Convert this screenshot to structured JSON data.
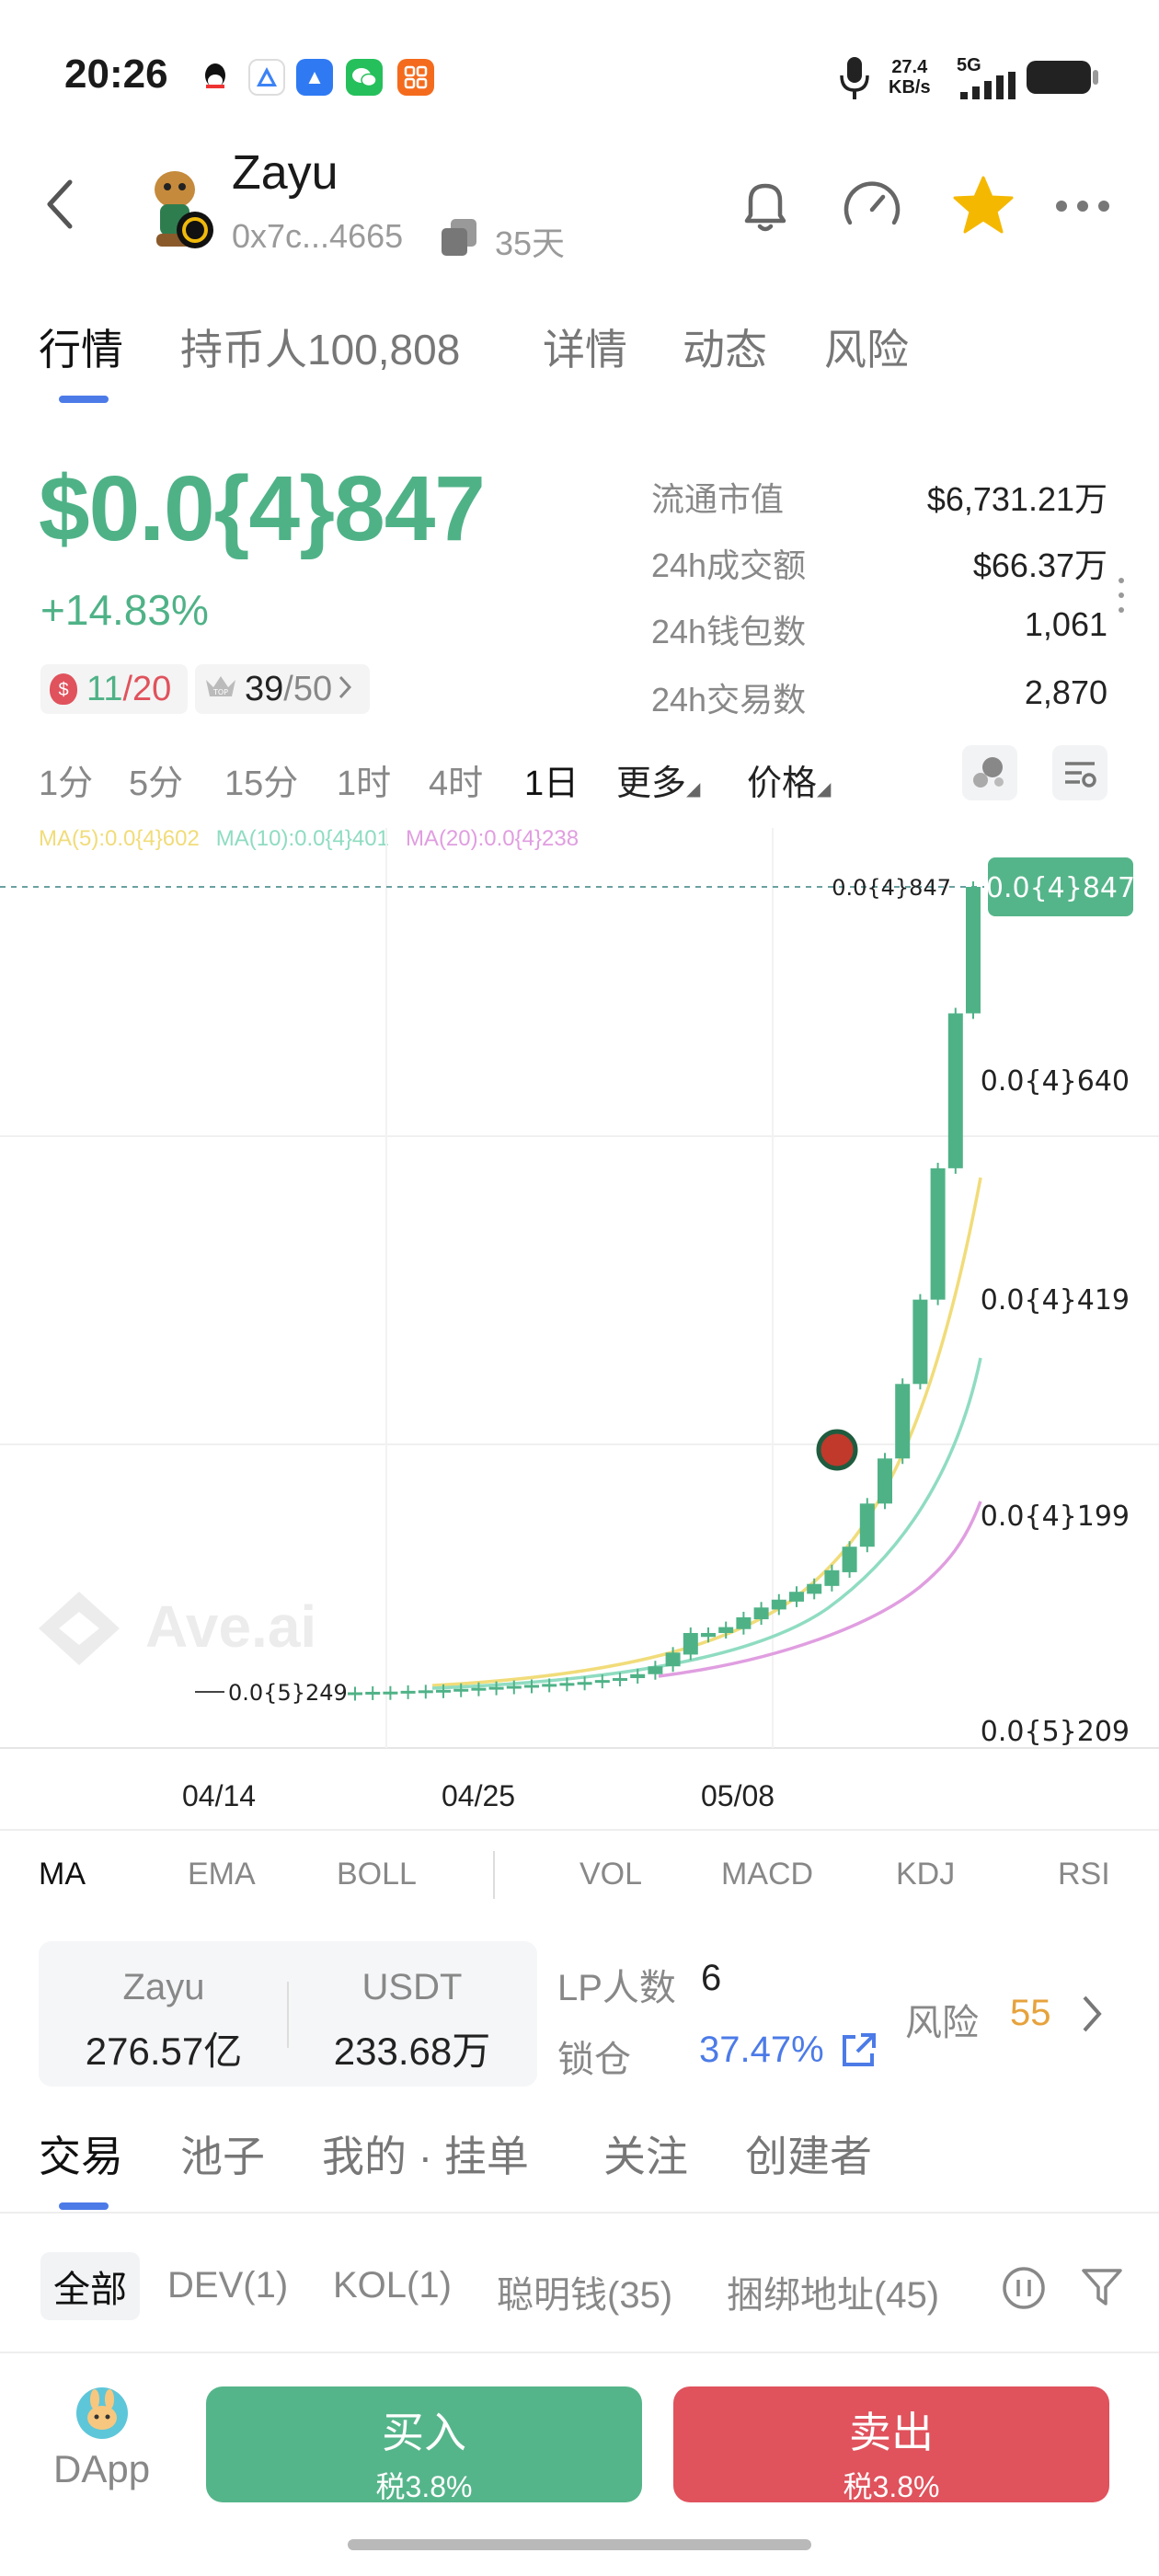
{
  "status_bar": {
    "time": "20:26",
    "net_speed_value": "27.4",
    "net_speed_unit": "KB/s",
    "network": "5G",
    "app_icons": [
      "qq-icon",
      "alipay-icon",
      "feishu-icon",
      "wechat-icon",
      "taobao-icon"
    ]
  },
  "header": {
    "name": "Zayu",
    "address": "0x7c...4665",
    "age": "35天"
  },
  "tabs": [
    "行情",
    "持币人100,808",
    "详情",
    "动态",
    "风险"
  ],
  "price": {
    "value": "$0.0{4}847",
    "change": "+14.83%",
    "badge1_value": "11",
    "badge1_total": "/20",
    "badge2_value": "39",
    "badge2_total": "/50"
  },
  "stats": [
    {
      "label": "流通市值",
      "value": "$6,731.21万"
    },
    {
      "label": "24h成交额",
      "value": "$66.37万"
    },
    {
      "label": "24h钱包数",
      "value": "1,061"
    },
    {
      "label": "24h交易数",
      "value": "2,870"
    }
  ],
  "timeframes": [
    "1分",
    "5分",
    "15分",
    "1时",
    "4时",
    "1日",
    "更多",
    "价格"
  ],
  "active_timeframe": "1日",
  "ma_legend": {
    "ma5": "MA(5):0.0{4}602",
    "ma10": "MA(10):0.0{4}401",
    "ma20": "MA(20):0.0{4}238"
  },
  "chart_data": {
    "type": "candlestick",
    "price_axis_labels": [
      "0.0{4}640",
      "0.0{4}419",
      "0.0{4}199",
      "0.0{5}209"
    ],
    "current_price_label": "0.0{4}847",
    "low_marker": "0.0{5}249",
    "x_labels": [
      "04/14",
      "04/25",
      "05/08"
    ],
    "watermark": "Ave.ai",
    "unit": "× 1e-5 USDT",
    "candles": [
      {
        "o": 2.5,
        "c": 2.55
      },
      {
        "o": 2.55,
        "c": 2.6
      },
      {
        "o": 2.6,
        "c": 2.62
      },
      {
        "o": 2.62,
        "c": 2.7
      },
      {
        "o": 2.7,
        "c": 2.75
      },
      {
        "o": 2.75,
        "c": 2.8
      },
      {
        "o": 2.8,
        "c": 2.9
      },
      {
        "o": 2.9,
        "c": 3.0
      },
      {
        "o": 3.0,
        "c": 3.1
      },
      {
        "o": 3.1,
        "c": 3.2
      },
      {
        "o": 3.2,
        "c": 3.3
      },
      {
        "o": 3.3,
        "c": 3.4
      },
      {
        "o": 3.4,
        "c": 3.5
      },
      {
        "o": 3.5,
        "c": 3.6
      },
      {
        "o": 3.6,
        "c": 3.8
      },
      {
        "o": 3.8,
        "c": 4.0
      },
      {
        "o": 4.0,
        "c": 4.4
      },
      {
        "o": 4.4,
        "c": 5.2
      },
      {
        "o": 5.2,
        "c": 6.6
      },
      {
        "o": 6.4,
        "c": 8.6
      },
      {
        "o": 8.2,
        "c": 8.6
      },
      {
        "o": 8.6,
        "c": 9.2
      },
      {
        "o": 9.0,
        "c": 10.2
      },
      {
        "o": 10.0,
        "c": 11.2
      },
      {
        "o": 11.0,
        "c": 12.0
      },
      {
        "o": 11.8,
        "c": 12.8
      },
      {
        "o": 12.6,
        "c": 13.6
      },
      {
        "o": 13.4,
        "c": 15.0
      },
      {
        "o": 14.8,
        "c": 17.4
      },
      {
        "o": 17.4,
        "c": 21.8
      },
      {
        "o": 21.8,
        "c": 26.4
      },
      {
        "o": 26.4,
        "c": 34.0
      },
      {
        "o": 34.0,
        "c": 42.6
      },
      {
        "o": 42.6,
        "c": 56.0
      },
      {
        "o": 56.0,
        "c": 71.8
      },
      {
        "o": 71.8,
        "c": 84.7
      }
    ]
  },
  "indicators": [
    "MA",
    "EMA",
    "BOLL",
    "VOL",
    "MACD",
    "KDJ",
    "RSI"
  ],
  "liquidity": {
    "token_label": "Zayu",
    "token_value": "276.57亿",
    "quote_label": "USDT",
    "quote_value": "233.68万",
    "lp_label": "LP人数",
    "lp_value": "6",
    "lock_label": "锁仓",
    "lock_value": "37.47%",
    "risk_label": "风险",
    "risk_value": "55"
  },
  "bottom_tabs": [
    "交易",
    "池子",
    "我的 · 挂单",
    "关注",
    "创建者"
  ],
  "filters": [
    "全部",
    "DEV(1)",
    "KOL(1)",
    "聪明钱(35)",
    "捆绑地址(45)"
  ],
  "actions": {
    "dapp": "DApp",
    "buy": "买入",
    "buy_tax": "税3.8%",
    "sell": "卖出",
    "sell_tax": "税3.8%"
  },
  "colors": {
    "up": "#4fb287",
    "down": "#e0525c",
    "accent": "#4c7be8",
    "ma5": "#f1dc7a",
    "ma10": "#8fdcc1",
    "ma20": "#e09ee0",
    "risk": "#e6a23c"
  }
}
